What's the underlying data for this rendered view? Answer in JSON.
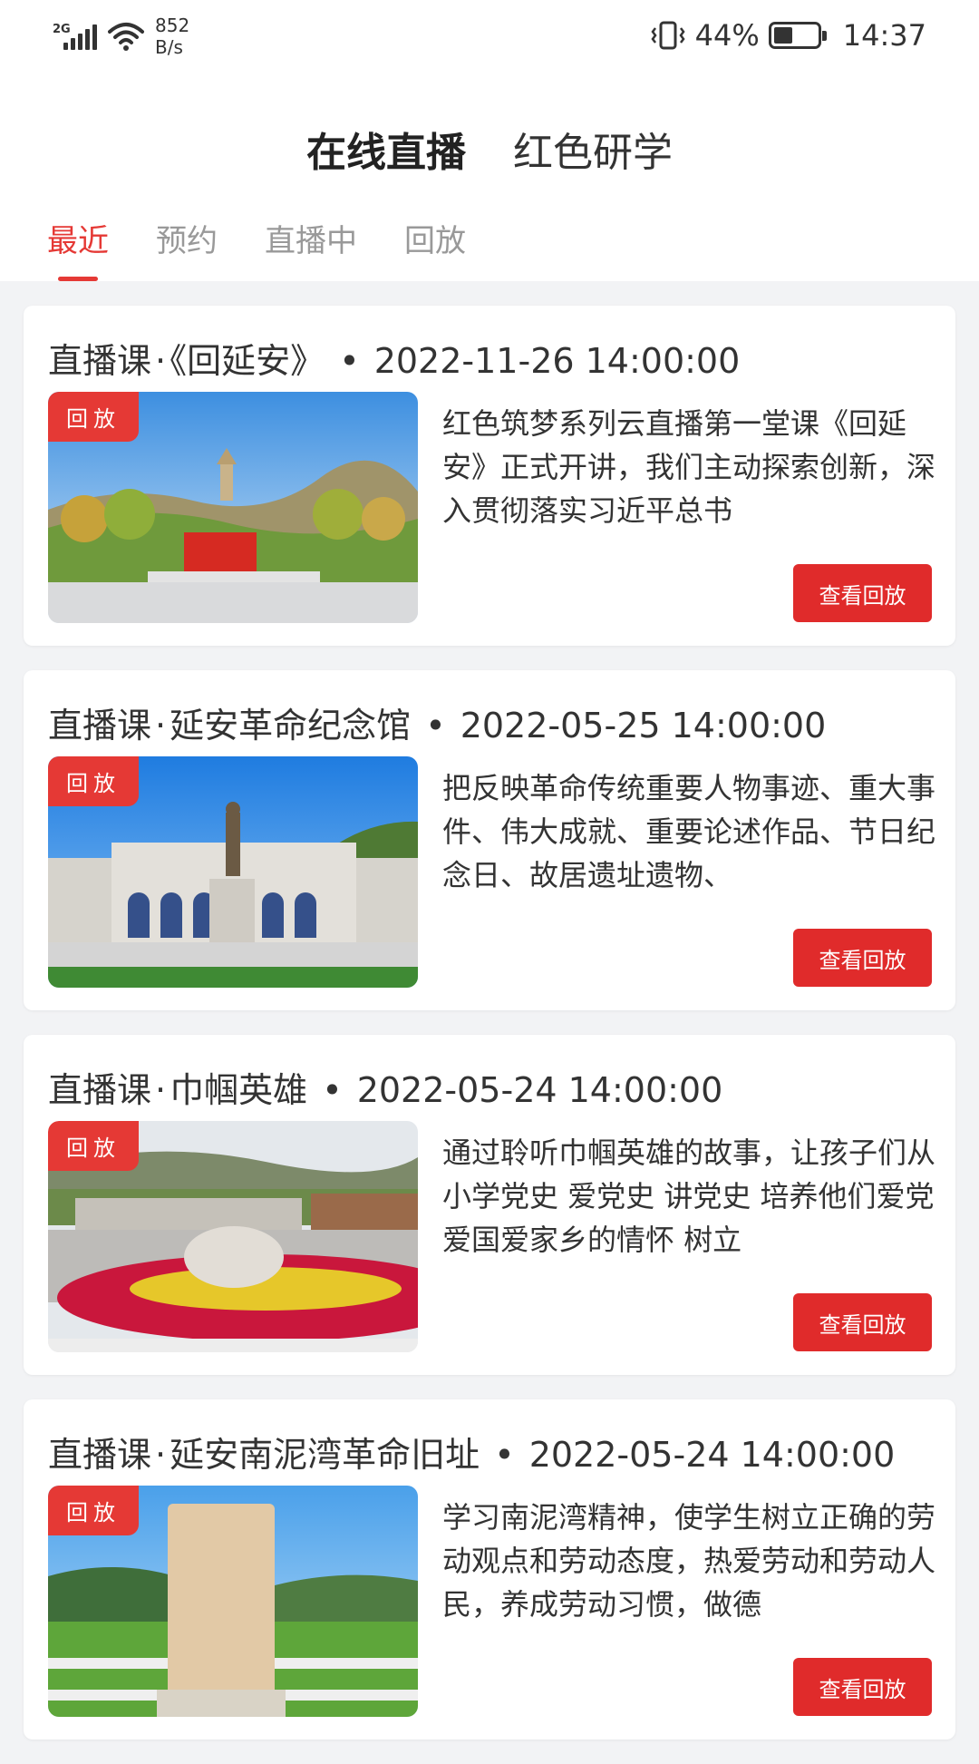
{
  "status_bar": {
    "network": "2G",
    "speed_value": "852",
    "speed_unit": "B/s",
    "battery": "44%",
    "battery_level": 0.44,
    "time": "14:37"
  },
  "header": {
    "main_tabs": [
      {
        "label": "在线直播",
        "active": true
      },
      {
        "label": "红色研学",
        "active": false
      }
    ],
    "sub_tabs": [
      {
        "label": "最近",
        "active": true
      },
      {
        "label": "预约",
        "active": false
      },
      {
        "label": "直播中",
        "active": false
      },
      {
        "label": "回放",
        "active": false
      }
    ]
  },
  "cards": [
    {
      "category": "直播课",
      "name": "《回延安》",
      "datetime": "2022-11-26 14:00:00",
      "badge": "回放",
      "description": "红色筑梦系列云直播第一堂课《回延安》正式开讲，我们主动探索创新，深入贯彻落实习近平总书",
      "button": "查看回放"
    },
    {
      "category": "直播课",
      "name": "延安革命纪念馆",
      "datetime": "2022-05-25 14:00:00",
      "badge": "回放",
      "description": "把反映革命传统重要人物事迹、重大事件、伟大成就、重要论述作品、节日纪念日、故居遗址遗物、",
      "button": "查看回放"
    },
    {
      "category": "直播课",
      "name": "巾帼英雄",
      "datetime": "2022-05-24 14:00:00",
      "badge": "回放",
      "description": "通过聆听巾帼英雄的故事，让孩子们从小学党史 爱党史 讲党史 培养他们爱党爱国爱家乡的情怀 树立",
      "button": "查看回放"
    },
    {
      "category": "直播课",
      "name": "延安南泥湾革命旧址",
      "datetime": "2022-05-24 14:00:00",
      "badge": "回放",
      "description": "学习南泥湾精神，使学生树立正确的劳动观点和劳动态度，热爱劳动和劳动人民，养成劳动习惯，做德",
      "button": "查看回放"
    }
  ],
  "colors": {
    "accent": "#e53935",
    "button": "#e02b2b",
    "background": "#f2f3f5"
  }
}
